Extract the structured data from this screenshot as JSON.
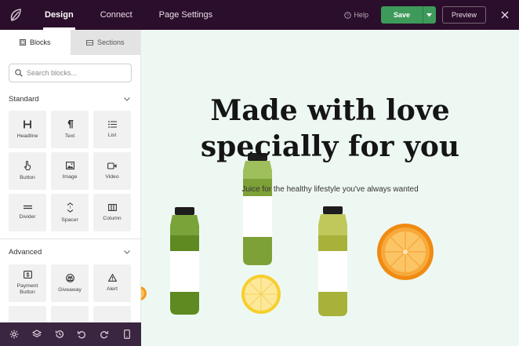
{
  "topbar": {
    "tabs": [
      {
        "label": "Design",
        "active": true
      },
      {
        "label": "Connect",
        "active": false
      },
      {
        "label": "Page Settings",
        "active": false
      }
    ],
    "help_label": "Help",
    "save_label": "Save",
    "preview_label": "Preview"
  },
  "sidebar": {
    "tabs": [
      {
        "label": "Blocks",
        "active": true
      },
      {
        "label": "Sections",
        "active": false
      }
    ],
    "search_placeholder": "Search blocks...",
    "standard": {
      "title": "Standard",
      "blocks": [
        {
          "label": "Headline",
          "icon": "headline-icon"
        },
        {
          "label": "Text",
          "icon": "paragraph-icon"
        },
        {
          "label": "List",
          "icon": "list-icon"
        },
        {
          "label": "Button",
          "icon": "pointer-icon"
        },
        {
          "label": "Image",
          "icon": "image-icon"
        },
        {
          "label": "Video",
          "icon": "video-icon"
        },
        {
          "label": "Divider",
          "icon": "divider-icon"
        },
        {
          "label": "Spacer",
          "icon": "spacer-icon"
        },
        {
          "label": "Column",
          "icon": "column-icon"
        }
      ]
    },
    "advanced": {
      "title": "Advanced",
      "blocks": [
        {
          "label": "Payment Button",
          "icon": "payment-icon"
        },
        {
          "label": "Giveaway",
          "icon": "giveaway-icon"
        },
        {
          "label": "Alert",
          "icon": "alert-icon"
        }
      ]
    }
  },
  "canvas": {
    "headline_line1": "Made with love",
    "headline_line2": "specially for you",
    "subtitle": "Juice for the healthy lifestyle you've always wanted"
  },
  "colors": {
    "topbar": "#2b0e2b",
    "save_green": "#3e9a5a",
    "canvas_bg": "#eef8f3",
    "bottombar": "#3a2640"
  }
}
